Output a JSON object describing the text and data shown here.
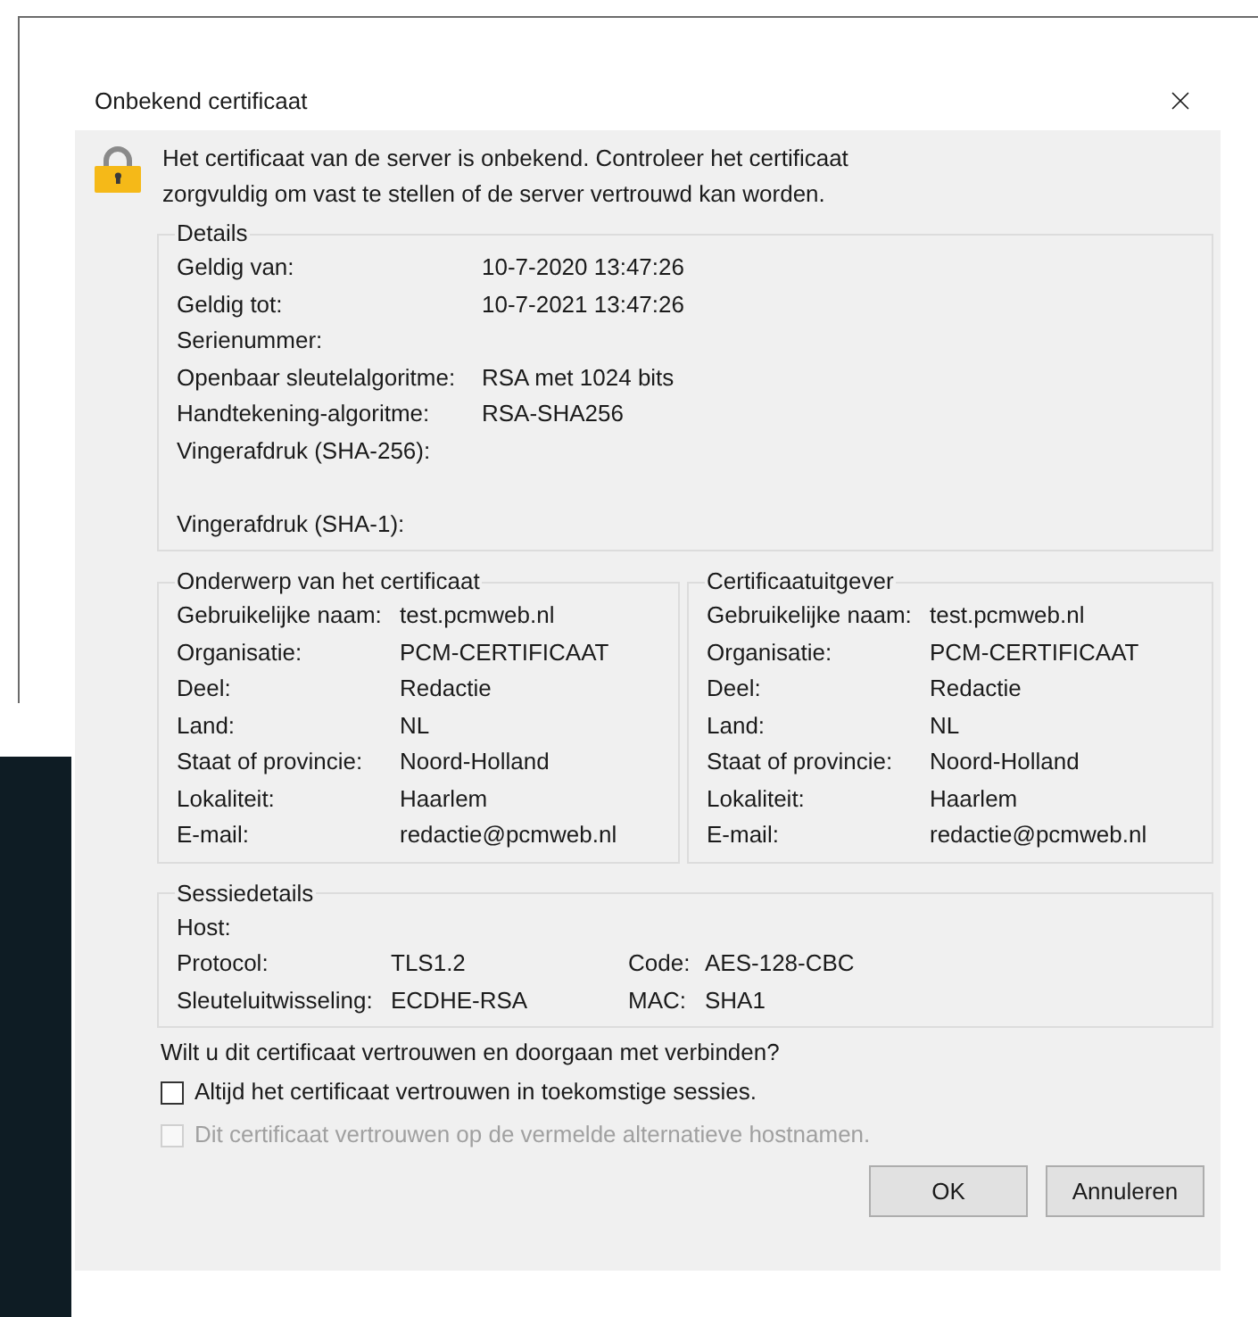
{
  "dialog": {
    "title": "Onbekend certificaat",
    "message": "Het certificaat van de server is onbekend. Controleer het certificaat zorgvuldig om vast te stellen of de server vertrouwd kan worden.",
    "details": {
      "legend": "Details",
      "rows": [
        {
          "label": "Geldig van:",
          "value": "10-7-2020 13:47:26"
        },
        {
          "label": "Geldig tot:",
          "value": "10-7-2021 13:47:26"
        },
        {
          "label": "Serienummer:"
        },
        {
          "label": "Openbaar sleutelalgoritme:",
          "value": "RSA met 1024 bits"
        },
        {
          "label": "Handtekening-algoritme:",
          "value": "RSA-SHA256"
        },
        {
          "label": "Vingerafdruk (SHA-256):",
          "kind": "multiline"
        },
        {
          "label": "Vingerafdruk (SHA-1):"
        }
      ]
    },
    "subject": {
      "legend": "Onderwerp van het certificaat",
      "rows": [
        {
          "label": "Gebruikelijke naam:",
          "value": "test.pcmweb.nl"
        },
        {
          "label": "Organisatie:",
          "value": "PCM-CERTIFICAAT"
        },
        {
          "label": "Deel:",
          "value": "Redactie"
        },
        {
          "label": "Land:",
          "value": "NL"
        },
        {
          "label": "Staat of provincie:",
          "value": "Noord-Holland"
        },
        {
          "label": "Lokaliteit:",
          "value": "Haarlem"
        },
        {
          "label": "E-mail:",
          "value": "redactie@pcmweb.nl"
        }
      ]
    },
    "issuer": {
      "legend": "Certificaatuitgever",
      "rows": [
        {
          "label": "Gebruikelijke naam:",
          "value": "test.pcmweb.nl"
        },
        {
          "label": "Organisatie:",
          "value": "PCM-CERTIFICAAT"
        },
        {
          "label": "Deel:",
          "value": "Redactie"
        },
        {
          "label": "Land:",
          "value": "NL"
        },
        {
          "label": "Staat of provincie:",
          "value": "Noord-Holland"
        },
        {
          "label": "Lokaliteit:",
          "value": "Haarlem"
        },
        {
          "label": "E-mail:",
          "value": "redactie@pcmweb.nl"
        }
      ]
    },
    "session": {
      "legend": "Sessiedetails",
      "rows": [
        {
          "label": "Host:"
        },
        {
          "label": "Protocol:",
          "value": "TLS1.2",
          "extra_label": "Code:",
          "extra_value": "AES-128-CBC"
        },
        {
          "label": "Sleuteluitwisseling:",
          "value": "ECDHE-RSA",
          "extra_label": "MAC:",
          "extra_value": "SHA1"
        }
      ]
    },
    "question": "Wilt u dit certificaat vertrouwen en doorgaan met verbinden?",
    "options": [
      {
        "label": "Altijd het certificaat vertrouwen in toekomstige sessies.",
        "checked": false,
        "disabled": false
      },
      {
        "label": "Dit certificaat vertrouwen op de vermelde alternatieve hostnamen.",
        "checked": false,
        "disabled": true
      }
    ],
    "buttons": [
      "OK",
      "Annuleren"
    ]
  }
}
